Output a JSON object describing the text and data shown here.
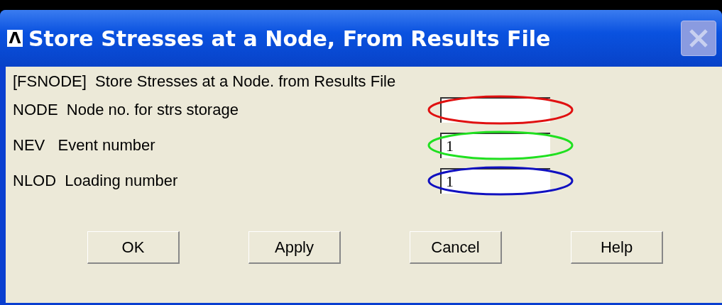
{
  "window": {
    "title": "Store Stresses at a Node, From Results File",
    "icon": "Λ"
  },
  "heading": "[FSNODE]  Store Stresses at a Node. from Results File",
  "fields": [
    {
      "label": "NODE  Node no. for strs storage",
      "color": "#e01010"
    },
    {
      "label": "NEV   Event number",
      "value": "1",
      "color": "#20e020"
    },
    {
      "label": "NLOD  Loading number",
      "value": "1",
      "color": "#1010c0"
    }
  ],
  "buttons": [
    "OK",
    "Apply",
    "Cancel",
    "Help"
  ]
}
